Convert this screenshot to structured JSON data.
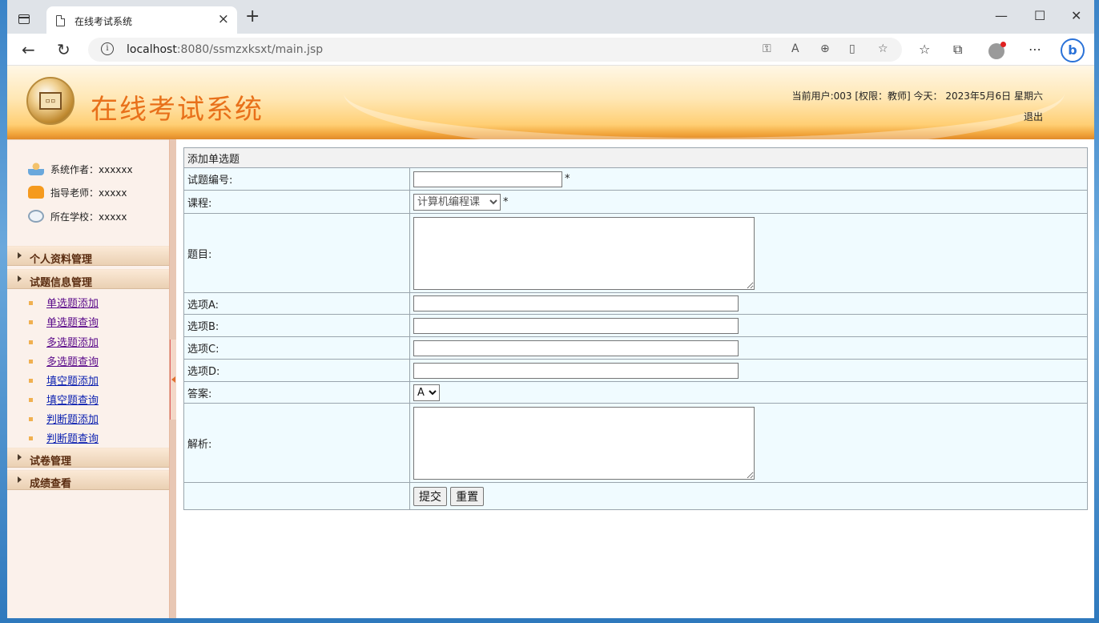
{
  "browser": {
    "tab_title": "在线考试系统",
    "url_host": "localhost",
    "url_rest": ":8080/ssmzxksxt/main.jsp"
  },
  "header": {
    "site_title": "在线考试系统",
    "user_info": "当前用户:003 [权限：教师] 今天： 2023年5月6日 星期六",
    "logout": "退出"
  },
  "sidebar": {
    "info": [
      {
        "label": "系统作者：xxxxxx",
        "icon": "users-icon"
      },
      {
        "label": "指导老师：xxxxx",
        "icon": "phone-icon"
      },
      {
        "label": "所在学校：xxxxx",
        "icon": "clock-icon"
      }
    ],
    "menus": [
      {
        "label": "个人资料管理"
      },
      {
        "label": "试题信息管理"
      },
      {
        "label": "试卷管理"
      },
      {
        "label": "成绩查看"
      }
    ],
    "submenu": [
      "单选题添加",
      "单选题查询",
      "多选题添加",
      "多选题查询",
      "填空题添加",
      "填空题查询",
      "判断题添加",
      "判断题查询"
    ]
  },
  "form": {
    "caption": "添加单选题",
    "fields": {
      "id_label": "试题编号:",
      "course_label": "课程:",
      "course_value": "计算机编程课",
      "question_label": "题目:",
      "a_label": "选项A:",
      "b_label": "选项B:",
      "c_label": "选项C:",
      "d_label": "选项D:",
      "answer_label": "答案:",
      "answer_value": "A",
      "analysis_label": "解析:"
    },
    "required_mark": "*",
    "submit": "提交",
    "reset": "重置"
  }
}
